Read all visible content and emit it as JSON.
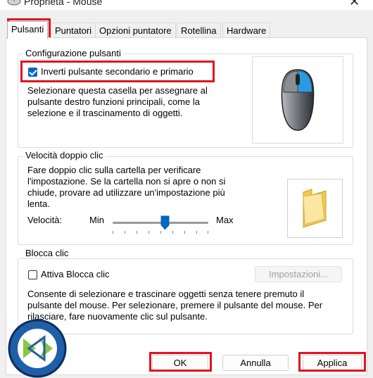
{
  "window": {
    "title": "Proprietà - Mouse",
    "close_glyph": "✕"
  },
  "tabs": [
    {
      "label": "Pulsanti",
      "active": true
    },
    {
      "label": "Puntatori"
    },
    {
      "label": "Opzioni puntatore"
    },
    {
      "label": "Rotellina"
    },
    {
      "label": "Hardware"
    }
  ],
  "buttons_config": {
    "legend": "Configurazione pulsanti",
    "checkbox_label": "Inverti pulsante secondario e primario",
    "checked": true,
    "desc_lines": [
      "Selezionare questa casella per assegnare al",
      "pulsante destro funzioni principali, come la",
      "selezione e il trascinamento di oggetti."
    ]
  },
  "double_click": {
    "legend": "Velocità doppio clic",
    "desc_lines": [
      "Fare doppio clic sulla cartella per verificare",
      "l'impostazione. Se la cartella non si apre o non si",
      "chiude, provare ad utilizzare un'impostazione più",
      "lenta."
    ],
    "speed_label": "Velocità:",
    "min_label": "Min",
    "max_label": "Max",
    "speed_value": 0.55
  },
  "click_lock": {
    "legend": "Blocca clic",
    "checkbox_label": "Attiva Blocca clic",
    "checked": false,
    "settings_button": "Impostazioni...",
    "desc_lines": [
      "Consente di selezionare e trascinare oggetti senza tenere premuto il",
      "pulsante del mouse. Per selezionare, premere il pulsante del mouse. Per",
      "rilasciare, fare nuovamente clic sul pulsante."
    ]
  },
  "footer": {
    "ok": "OK",
    "cancel": "Annulla",
    "apply": "Applica"
  },
  "colors": {
    "accent": "#0067c0",
    "highlight_box": "#e0141e",
    "logo_bg": "#1f5fa8",
    "logo_green": "#8cc63f"
  }
}
